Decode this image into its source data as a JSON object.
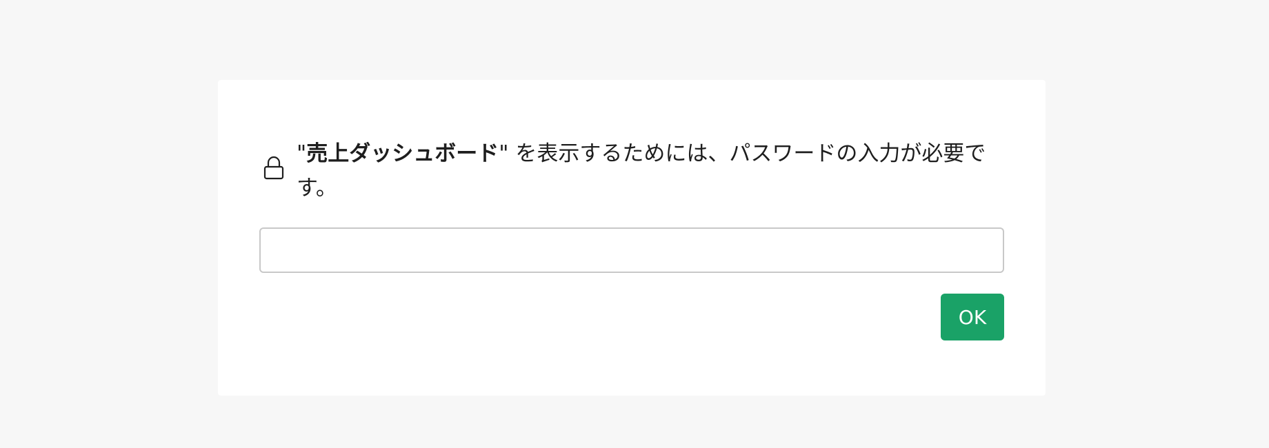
{
  "dialog": {
    "quote_open": "\"",
    "dashboard_name": "売上ダッシュボード",
    "message_suffix": "\" を表示するためには、パスワードの入力が必要です。",
    "password_value": "",
    "ok_label": "OK"
  },
  "colors": {
    "background": "#f7f7f7",
    "card": "#ffffff",
    "accent": "#1aa267"
  },
  "icons": {
    "lock": "lock-icon"
  }
}
